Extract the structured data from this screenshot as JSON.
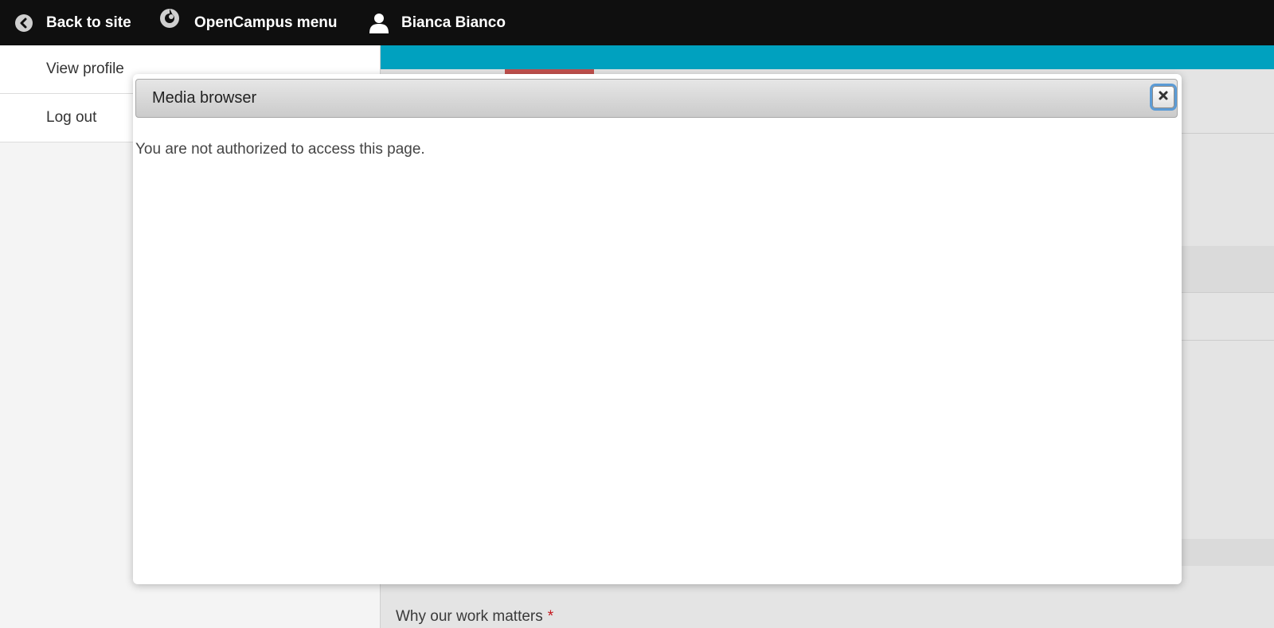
{
  "toolbar": {
    "back_label": "Back to site",
    "menu_label": "OpenCampus menu",
    "user_label": "Bianca Bianco"
  },
  "tray": {
    "items": [
      {
        "label": "View profile"
      },
      {
        "label": "Log out"
      }
    ]
  },
  "modal": {
    "title": "Media browser",
    "message": "You are not authorized to access this page."
  },
  "background": {
    "field_label": "Why our work matters",
    "required_marker": "*"
  },
  "colors": {
    "toolbar_bg": "#0f0f0f",
    "banner": "#00a1bf",
    "required": "#c4161c",
    "focus_ring": "#5b9bd5"
  },
  "icons": {
    "back": "chevron-left-circle-icon",
    "menu": "opencampus-logo-icon",
    "user": "user-icon",
    "close": "close-icon"
  }
}
